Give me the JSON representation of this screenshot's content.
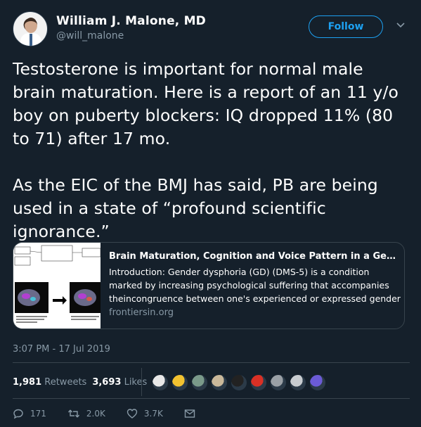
{
  "author": {
    "name": "William J. Malone, MD",
    "handle": "@will_malone"
  },
  "follow_label": "Follow",
  "tweet_text": "Testosterone is important for normal male brain maturation. Here is a report of an 11 y/o boy on puberty blockers: IQ dropped 11% (80 to 71) after 17 mo.\n\nAs the EIC of the BMJ has said, PB are being used in a state of “profound scientific ignorance.”",
  "card": {
    "title": "Brain Maturation, Cognition and Voice Pattern in a Gender ...",
    "description": "Introduction: Gender dysphoria (GD) (DMS-5) is a condition marked by increasing psychological suffering that accompanies theincongruence between one's experienced or expressed gender",
    "domain": "frontiersin.org"
  },
  "timestamp": "3:07 PM - 17 Jul 2019",
  "stats": {
    "retweets_count": "1,981",
    "retweets_label": "Retweets",
    "likes_count": "3,693",
    "likes_label": "Likes"
  },
  "liker_colors": [
    "#e8e8e8",
    "#f2c230",
    "#7a9a8a",
    "#c9b89a",
    "#222222",
    "#d93025",
    "#9aa0a6",
    "#c9cdd1",
    "#6b5bd6"
  ],
  "actions": {
    "replies": "171",
    "retweets": "2.0K",
    "likes": "3.7K"
  },
  "colors": {
    "background": "#15202b",
    "accent": "#1da1f2",
    "muted": "#8899a6",
    "border": "#38444d"
  }
}
